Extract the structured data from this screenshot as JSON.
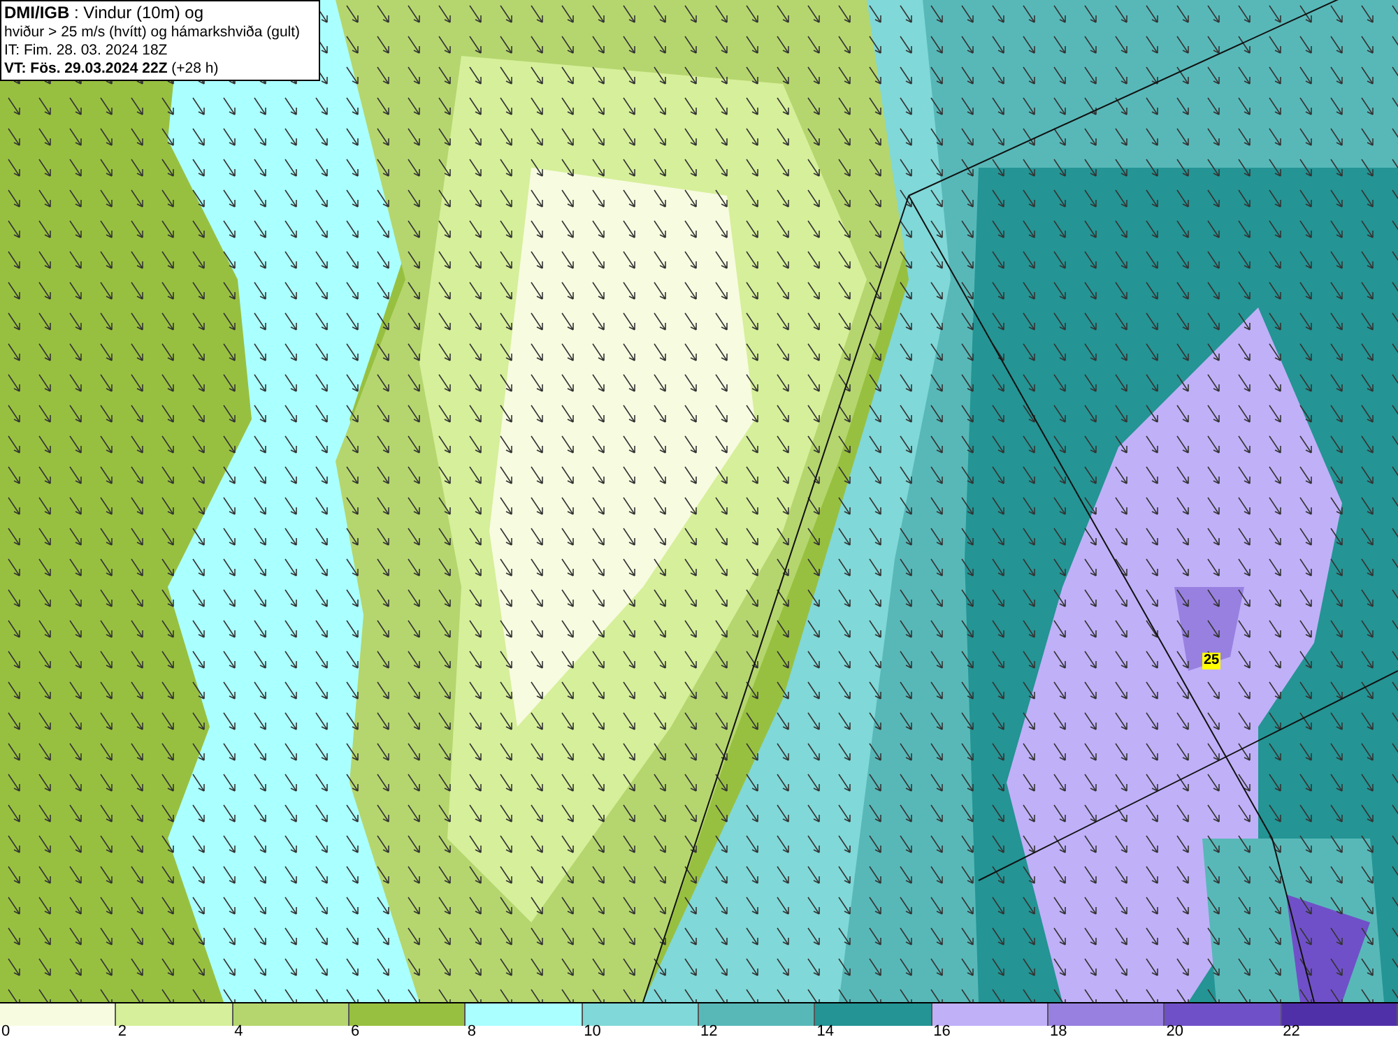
{
  "header": {
    "lines": [
      "**DMI/IGB** : Vindur (10m) og",
      "hviður > 25 m/s (hvítt) og hámarkshviða (gult)",
      "IT: Fim. 28. 03. 2024 18Z",
      "**VT: Fös. 29.03.2024 22Z** (+28 h)"
    ]
  },
  "gust_marker": {
    "label": "25"
  },
  "legend": [
    {
      "label": "0",
      "color": "#f7fbe0"
    },
    {
      "label": "2",
      "color": "#d6ef9a"
    },
    {
      "label": "4",
      "color": "#b5d66e"
    },
    {
      "label": "6",
      "color": "#98c040"
    },
    {
      "label": "8",
      "color": "#aaffff"
    },
    {
      "label": "10",
      "color": "#80d8d8"
    },
    {
      "label": "12",
      "color": "#58b8b8"
    },
    {
      "label": "14",
      "color": "#249494"
    },
    {
      "label": "16",
      "color": "#c0b0f8"
    },
    {
      "label": "18",
      "color": "#9880e0"
    },
    {
      "label": "20",
      "color": "#7050c8"
    },
    {
      "label": "22",
      "color": "#5030a8"
    }
  ]
}
